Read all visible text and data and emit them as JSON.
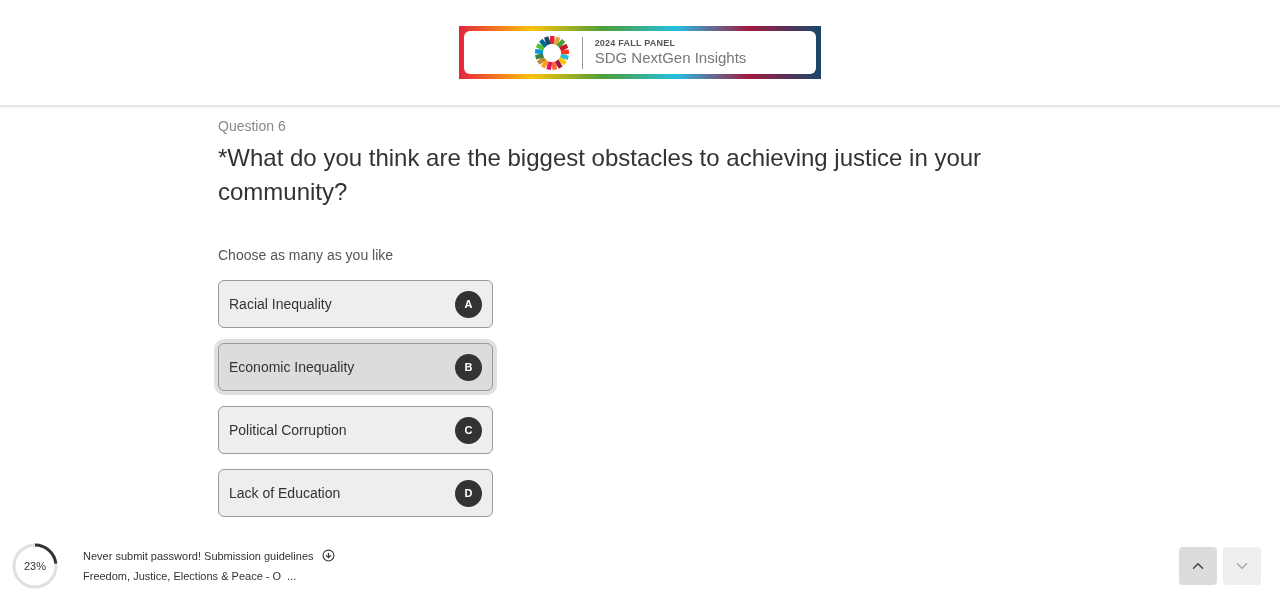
{
  "banner": {
    "kicker": "2024 FALL PANEL",
    "title": "SDG NextGen Insights"
  },
  "question": {
    "number": "Question 6",
    "text": "*What do you think are the biggest obstacles to achieving justice in your community?",
    "hint": "Choose as many as you like"
  },
  "options": [
    {
      "label": "Racial Inequality",
      "key": "A",
      "selected": false
    },
    {
      "label": "Economic Inequality",
      "key": "B",
      "selected": true
    },
    {
      "label": "Political Corruption",
      "key": "C",
      "selected": false
    },
    {
      "label": "Lack of Education",
      "key": "D",
      "selected": false
    }
  ],
  "footer": {
    "progress": {
      "reading": "23%"
    },
    "notice": "Never submit password! Submission guidelines",
    "topic": "Freedom, Justice, Elections & Peace - O",
    "more": "..."
  },
  "nav": [
    {
      "kind": "up",
      "disabled": false
    },
    {
      "kind": "down",
      "disabled": true
    }
  ]
}
